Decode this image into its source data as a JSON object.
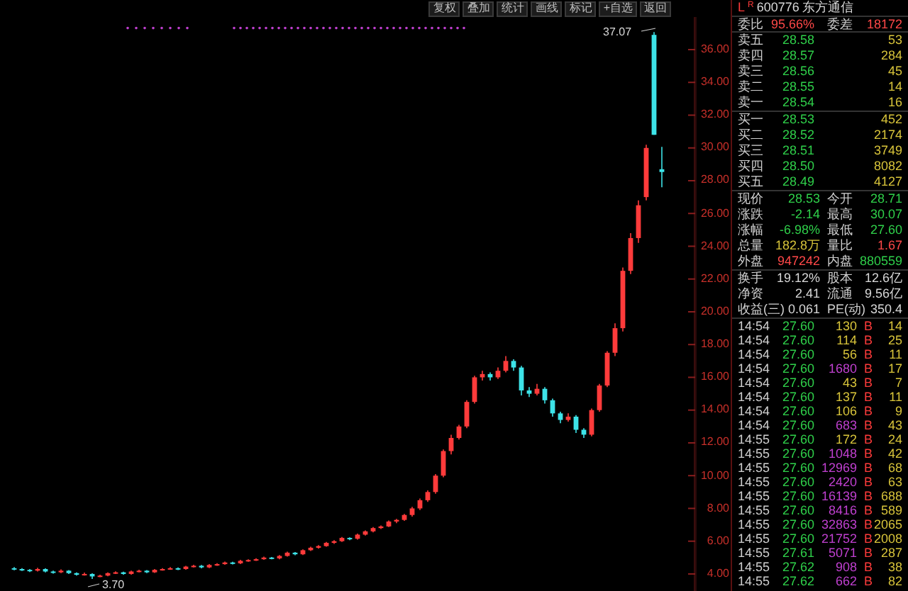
{
  "toolbar": [
    "复权",
    "叠加",
    "统计",
    "画线",
    "标记",
    "+自选",
    "返回"
  ],
  "chart": {
    "high_label": "37.07",
    "low_label": "3.70",
    "chart_data": {
      "type": "candlestick",
      "ohlc": [
        [
          4.35,
          4.42,
          4.22,
          4.3
        ],
        [
          4.3,
          4.36,
          4.18,
          4.25
        ],
        [
          4.25,
          4.3,
          4.12,
          4.2
        ],
        [
          4.2,
          4.38,
          4.15,
          4.3
        ],
        [
          4.3,
          4.34,
          4.1,
          4.15
        ],
        [
          4.15,
          4.2,
          4.02,
          4.1
        ],
        [
          4.1,
          4.28,
          4.05,
          4.2
        ],
        [
          4.2,
          4.24,
          4.0,
          4.05
        ],
        [
          4.05,
          4.1,
          3.9,
          3.95
        ],
        [
          3.95,
          4.08,
          3.9,
          4.0
        ],
        [
          4.0,
          4.04,
          3.7,
          3.85
        ],
        [
          3.85,
          3.96,
          3.8,
          3.9
        ],
        [
          3.9,
          4.1,
          3.86,
          4.05
        ],
        [
          4.05,
          4.16,
          4.0,
          4.1
        ],
        [
          4.1,
          4.14,
          3.95,
          4.0
        ],
        [
          4.0,
          4.2,
          3.96,
          4.15
        ],
        [
          4.15,
          4.26,
          4.1,
          4.2
        ],
        [
          4.2,
          4.24,
          4.05,
          4.1
        ],
        [
          4.1,
          4.3,
          4.06,
          4.25
        ],
        [
          4.25,
          4.36,
          4.2,
          4.3
        ],
        [
          4.3,
          4.42,
          4.26,
          4.35
        ],
        [
          4.35,
          4.4,
          4.24,
          4.3
        ],
        [
          4.3,
          4.5,
          4.26,
          4.45
        ],
        [
          4.45,
          4.56,
          4.4,
          4.5
        ],
        [
          4.5,
          4.55,
          4.34,
          4.4
        ],
        [
          4.4,
          4.6,
          4.36,
          4.55
        ],
        [
          4.55,
          4.66,
          4.5,
          4.6
        ],
        [
          4.6,
          4.76,
          4.56,
          4.7
        ],
        [
          4.7,
          4.74,
          4.58,
          4.65
        ],
        [
          4.65,
          4.86,
          4.6,
          4.8
        ],
        [
          4.8,
          4.9,
          4.74,
          4.85
        ],
        [
          4.85,
          4.96,
          4.8,
          4.9
        ],
        [
          4.9,
          5.06,
          4.86,
          5.0
        ],
        [
          5.0,
          5.04,
          4.9,
          4.95
        ],
        [
          4.95,
          5.16,
          4.9,
          5.1
        ],
        [
          5.1,
          5.36,
          5.06,
          5.3
        ],
        [
          5.3,
          5.34,
          5.14,
          5.2
        ],
        [
          5.2,
          5.5,
          5.16,
          5.45
        ],
        [
          5.45,
          5.66,
          5.4,
          5.6
        ],
        [
          5.6,
          5.76,
          5.54,
          5.7
        ],
        [
          5.7,
          5.96,
          5.66,
          5.9
        ],
        [
          5.9,
          6.06,
          5.84,
          6.0
        ],
        [
          6.0,
          6.26,
          5.96,
          6.2
        ],
        [
          6.2,
          6.24,
          6.06,
          6.15
        ],
        [
          6.15,
          6.46,
          6.1,
          6.4
        ],
        [
          6.4,
          6.66,
          6.34,
          6.6
        ],
        [
          6.6,
          6.86,
          6.54,
          6.8
        ],
        [
          6.8,
          6.96,
          6.74,
          6.9
        ],
        [
          6.9,
          7.26,
          6.86,
          7.2
        ],
        [
          7.2,
          7.36,
          7.1,
          7.3
        ],
        [
          7.3,
          7.66,
          7.24,
          7.6
        ],
        [
          7.6,
          8.1,
          7.5,
          8.0
        ],
        [
          8.0,
          8.6,
          7.9,
          8.5
        ],
        [
          8.5,
          9.1,
          8.4,
          9.0
        ],
        [
          9.0,
          10.1,
          8.9,
          10.0
        ],
        [
          10.0,
          11.6,
          9.9,
          11.5
        ],
        [
          11.5,
          12.5,
          11.3,
          12.3
        ],
        [
          12.3,
          13.1,
          12.2,
          13.0
        ],
        [
          13.0,
          14.6,
          12.9,
          14.5
        ],
        [
          14.5,
          16.1,
          14.4,
          16.0
        ],
        [
          16.0,
          16.4,
          15.8,
          16.2
        ],
        [
          16.2,
          16.3,
          15.8,
          16.0
        ],
        [
          16.0,
          16.6,
          15.9,
          16.4
        ],
        [
          16.4,
          17.3,
          16.3,
          17.0
        ],
        [
          17.0,
          17.1,
          16.4,
          16.6
        ],
        [
          16.6,
          16.7,
          14.9,
          15.2
        ],
        [
          15.2,
          15.4,
          14.8,
          15.0
        ],
        [
          15.0,
          15.6,
          14.9,
          15.3
        ],
        [
          15.3,
          15.4,
          14.4,
          14.6
        ],
        [
          14.6,
          14.7,
          13.6,
          13.8
        ],
        [
          13.8,
          13.9,
          13.2,
          13.4
        ],
        [
          13.4,
          13.8,
          13.3,
          13.6
        ],
        [
          13.6,
          13.7,
          12.6,
          12.8
        ],
        [
          12.8,
          12.9,
          12.3,
          12.5
        ],
        [
          12.5,
          14.1,
          12.4,
          14.0
        ],
        [
          14.0,
          15.6,
          13.9,
          15.5
        ],
        [
          15.5,
          17.6,
          15.4,
          17.5
        ],
        [
          17.5,
          19.3,
          17.3,
          19.0
        ],
        [
          19.0,
          22.7,
          18.8,
          22.5
        ],
        [
          22.5,
          24.8,
          22.3,
          24.5
        ],
        [
          24.5,
          26.8,
          24.2,
          26.5
        ],
        [
          27.0,
          30.2,
          26.8,
          30.0
        ],
        [
          36.9,
          37.07,
          30.8,
          30.8
        ],
        [
          28.7,
          30.07,
          27.6,
          28.53
        ]
      ],
      "ylim": [
        2.96,
        37.99
      ],
      "yticks": [
        {
          "value": 36,
          "label": "36.00"
        },
        {
          "value": 34,
          "label": "34.00"
        },
        {
          "value": 32,
          "label": "32.00"
        },
        {
          "value": 30,
          "label": "30.00"
        },
        {
          "value": 28,
          "label": "28.00"
        },
        {
          "value": 26,
          "label": "26.00"
        },
        {
          "value": 24,
          "label": "24.00"
        },
        {
          "value": 22,
          "label": "22.00"
        },
        {
          "value": 20,
          "label": "20.00"
        },
        {
          "value": 18,
          "label": "18.00"
        },
        {
          "value": 16,
          "label": "16.00"
        },
        {
          "value": 14,
          "label": "14.00"
        },
        {
          "value": 12,
          "label": "12.00"
        },
        {
          "value": 10,
          "label": "10.00"
        },
        {
          "value": 8,
          "label": "8.00"
        },
        {
          "value": 6,
          "label": "6.00"
        },
        {
          "value": 4,
          "label": "4.00"
        }
      ]
    }
  },
  "quote": {
    "tag": "L",
    "subtag": "R",
    "code": "600776",
    "name": "东方通信"
  },
  "ratio": [
    {
      "label": "委比",
      "value": "95.66%"
    },
    {
      "label": "委差",
      "value": "18172"
    }
  ],
  "asks": [
    {
      "label": "卖五",
      "price": "28.58",
      "volume": "53"
    },
    {
      "label": "卖四",
      "price": "28.57",
      "volume": "284"
    },
    {
      "label": "卖三",
      "price": "28.56",
      "volume": "45"
    },
    {
      "label": "卖二",
      "price": "28.55",
      "volume": "14"
    },
    {
      "label": "卖一",
      "price": "28.54",
      "volume": "16"
    }
  ],
  "bids": [
    {
      "label": "买一",
      "price": "28.53",
      "volume": "452"
    },
    {
      "label": "买二",
      "price": "28.52",
      "volume": "2174"
    },
    {
      "label": "买三",
      "price": "28.51",
      "volume": "3749"
    },
    {
      "label": "买四",
      "price": "28.50",
      "volume": "8082"
    },
    {
      "label": "买五",
      "price": "28.49",
      "volume": "4127"
    }
  ],
  "stats": [
    {
      "label": "现价",
      "value": "28.53",
      "color": "#2fd04a"
    },
    {
      "label": "今开",
      "value": "28.71",
      "color": "#2fd04a"
    },
    {
      "label": "涨跌",
      "value": "-2.14",
      "color": "#2fd04a"
    },
    {
      "label": "最高",
      "value": "30.07",
      "color": "#2fd04a"
    },
    {
      "label": "涨幅",
      "value": "-6.98%",
      "color": "#2fd04a"
    },
    {
      "label": "最低",
      "value": "27.60",
      "color": "#2fd04a"
    },
    {
      "label": "总量",
      "value": "182.8万",
      "color": "#d8c43a"
    },
    {
      "label": "量比",
      "value": "1.67",
      "color": "#ff4848"
    },
    {
      "label": "外盘",
      "value": "947242",
      "color": "#ff4848"
    },
    {
      "label": "内盘",
      "value": "880559",
      "color": "#2fd04a"
    }
  ],
  "fundamentals": [
    {
      "label": "换手",
      "value": "19.12%"
    },
    {
      "label": "股本",
      "value": "12.6亿"
    },
    {
      "label": "净资",
      "value": "2.41"
    },
    {
      "label": "流通",
      "value": "9.56亿"
    },
    {
      "label": "收益(三)",
      "value": "0.061"
    },
    {
      "label": "PE(动)",
      "value": "350.4"
    }
  ],
  "ticks": [
    {
      "time": "14:54",
      "price": "27.60",
      "volume": "130",
      "side": "B",
      "count": "14",
      "large": false
    },
    {
      "time": "14:54",
      "price": "27.60",
      "volume": "114",
      "side": "B",
      "count": "25",
      "large": false
    },
    {
      "time": "14:54",
      "price": "27.60",
      "volume": "56",
      "side": "B",
      "count": "11",
      "large": false
    },
    {
      "time": "14:54",
      "price": "27.60",
      "volume": "1680",
      "side": "B",
      "count": "17",
      "large": true
    },
    {
      "time": "14:54",
      "price": "27.60",
      "volume": "43",
      "side": "B",
      "count": "7",
      "large": false
    },
    {
      "time": "14:54",
      "price": "27.60",
      "volume": "137",
      "side": "B",
      "count": "11",
      "large": false
    },
    {
      "time": "14:54",
      "price": "27.60",
      "volume": "106",
      "side": "B",
      "count": "9",
      "large": false
    },
    {
      "time": "14:54",
      "price": "27.60",
      "volume": "683",
      "side": "B",
      "count": "43",
      "large": true
    },
    {
      "time": "14:55",
      "price": "27.60",
      "volume": "172",
      "side": "B",
      "count": "24",
      "large": false
    },
    {
      "time": "14:55",
      "price": "27.60",
      "volume": "1048",
      "side": "B",
      "count": "42",
      "large": true
    },
    {
      "time": "14:55",
      "price": "27.60",
      "volume": "12969",
      "side": "B",
      "count": "68",
      "large": true
    },
    {
      "time": "14:55",
      "price": "27.60",
      "volume": "2420",
      "side": "B",
      "count": "63",
      "large": true
    },
    {
      "time": "14:55",
      "price": "27.60",
      "volume": "16139",
      "side": "B",
      "count": "688",
      "large": true
    },
    {
      "time": "14:55",
      "price": "27.60",
      "volume": "8416",
      "side": "B",
      "count": "589",
      "large": true
    },
    {
      "time": "14:55",
      "price": "27.60",
      "volume": "32863",
      "side": "B",
      "count": "2065",
      "large": true
    },
    {
      "time": "14:55",
      "price": "27.60",
      "volume": "21752",
      "side": "B",
      "count": "2008",
      "large": true
    },
    {
      "time": "14:55",
      "price": "27.61",
      "volume": "5071",
      "side": "B",
      "count": "287",
      "large": true
    },
    {
      "time": "14:55",
      "price": "27.62",
      "volume": "908",
      "side": "B",
      "count": "38",
      "large": true
    },
    {
      "time": "14:55",
      "price": "27.62",
      "volume": "662",
      "side": "B",
      "count": "82",
      "large": true
    }
  ]
}
